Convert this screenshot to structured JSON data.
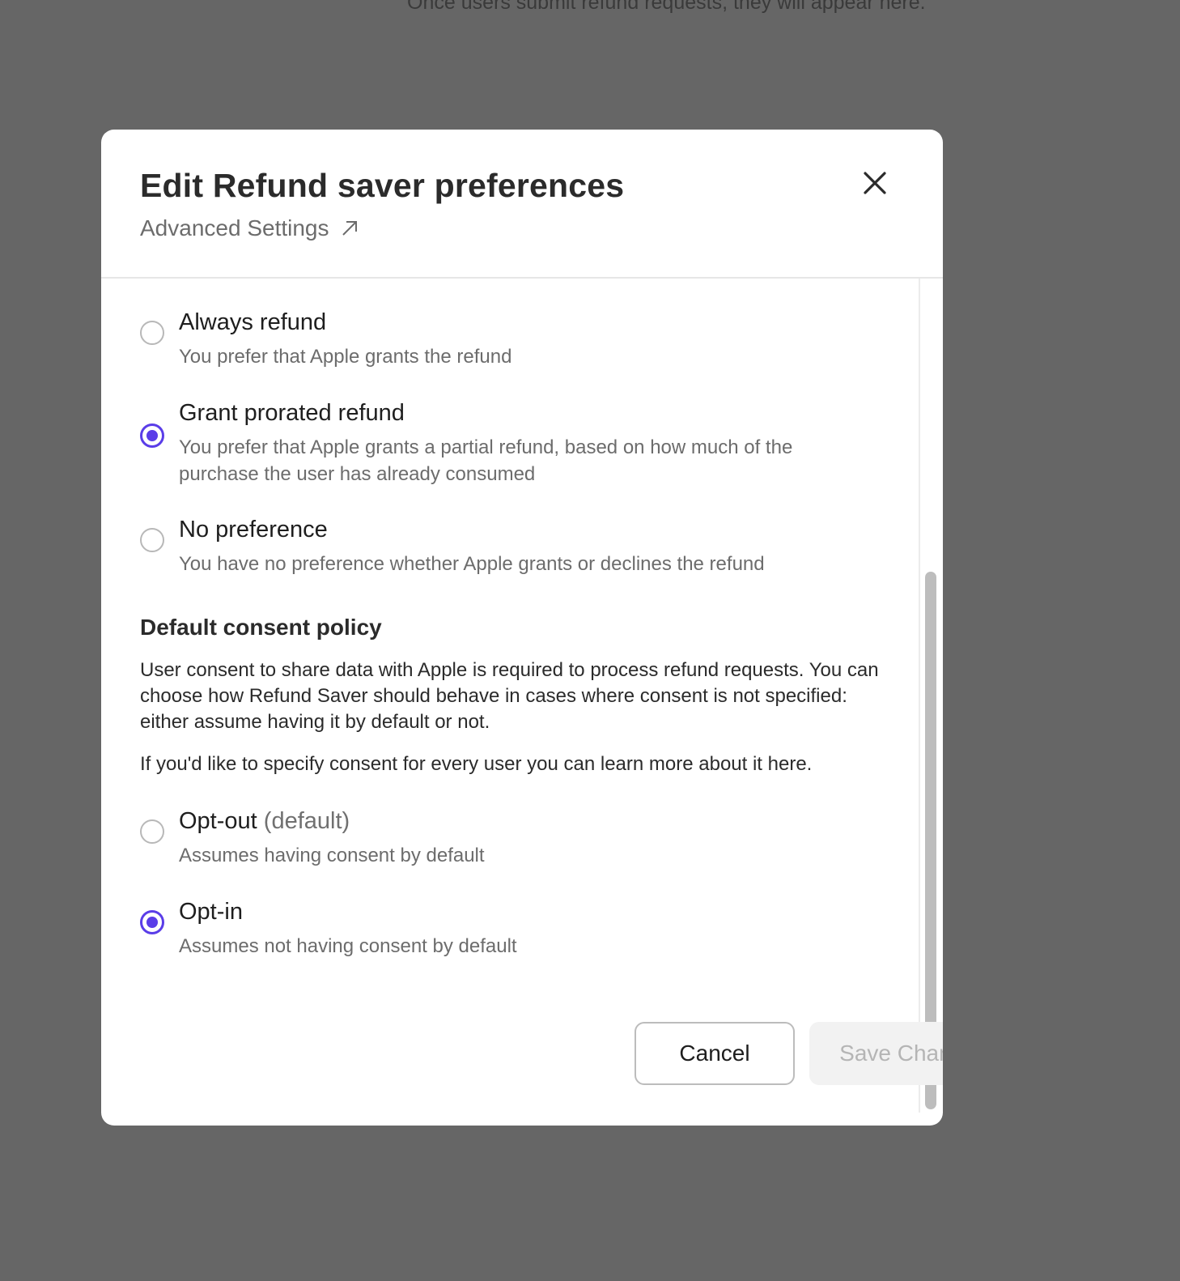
{
  "background": {
    "partial_text": "Once users submit refund requests, they will appear here."
  },
  "modal": {
    "title": "Edit Refund saver preferences",
    "advanced_link": "Advanced Settings",
    "refund_options": [
      {
        "label": "Always refund",
        "description": "You prefer that Apple grants the refund",
        "checked": false
      },
      {
        "label": "Grant prorated refund",
        "description": "You prefer that Apple grants a partial refund, based on how much of the purchase the user has already consumed",
        "checked": true
      },
      {
        "label": "No preference",
        "description": "You have no preference whether Apple grants or declines the refund",
        "checked": false
      }
    ],
    "consent_section": {
      "title": "Default consent policy",
      "paragraph1": "User consent to share data with Apple is required to process refund requests. You can choose how Refund Saver should behave in cases where consent is not specified: either assume having it by default or not.",
      "paragraph2": "If you'd like to specify consent for every user you can learn more about it here."
    },
    "consent_options": [
      {
        "label": "Opt-out",
        "suffix": "(default)",
        "description": "Assumes having consent by default",
        "checked": false
      },
      {
        "label": "Opt-in",
        "suffix": "",
        "description": "Assumes not having consent by default",
        "checked": true
      }
    ],
    "buttons": {
      "cancel": "Cancel",
      "save": "Save Changes"
    },
    "colors": {
      "accent": "#5a3de8",
      "overlay": "#666666"
    }
  }
}
